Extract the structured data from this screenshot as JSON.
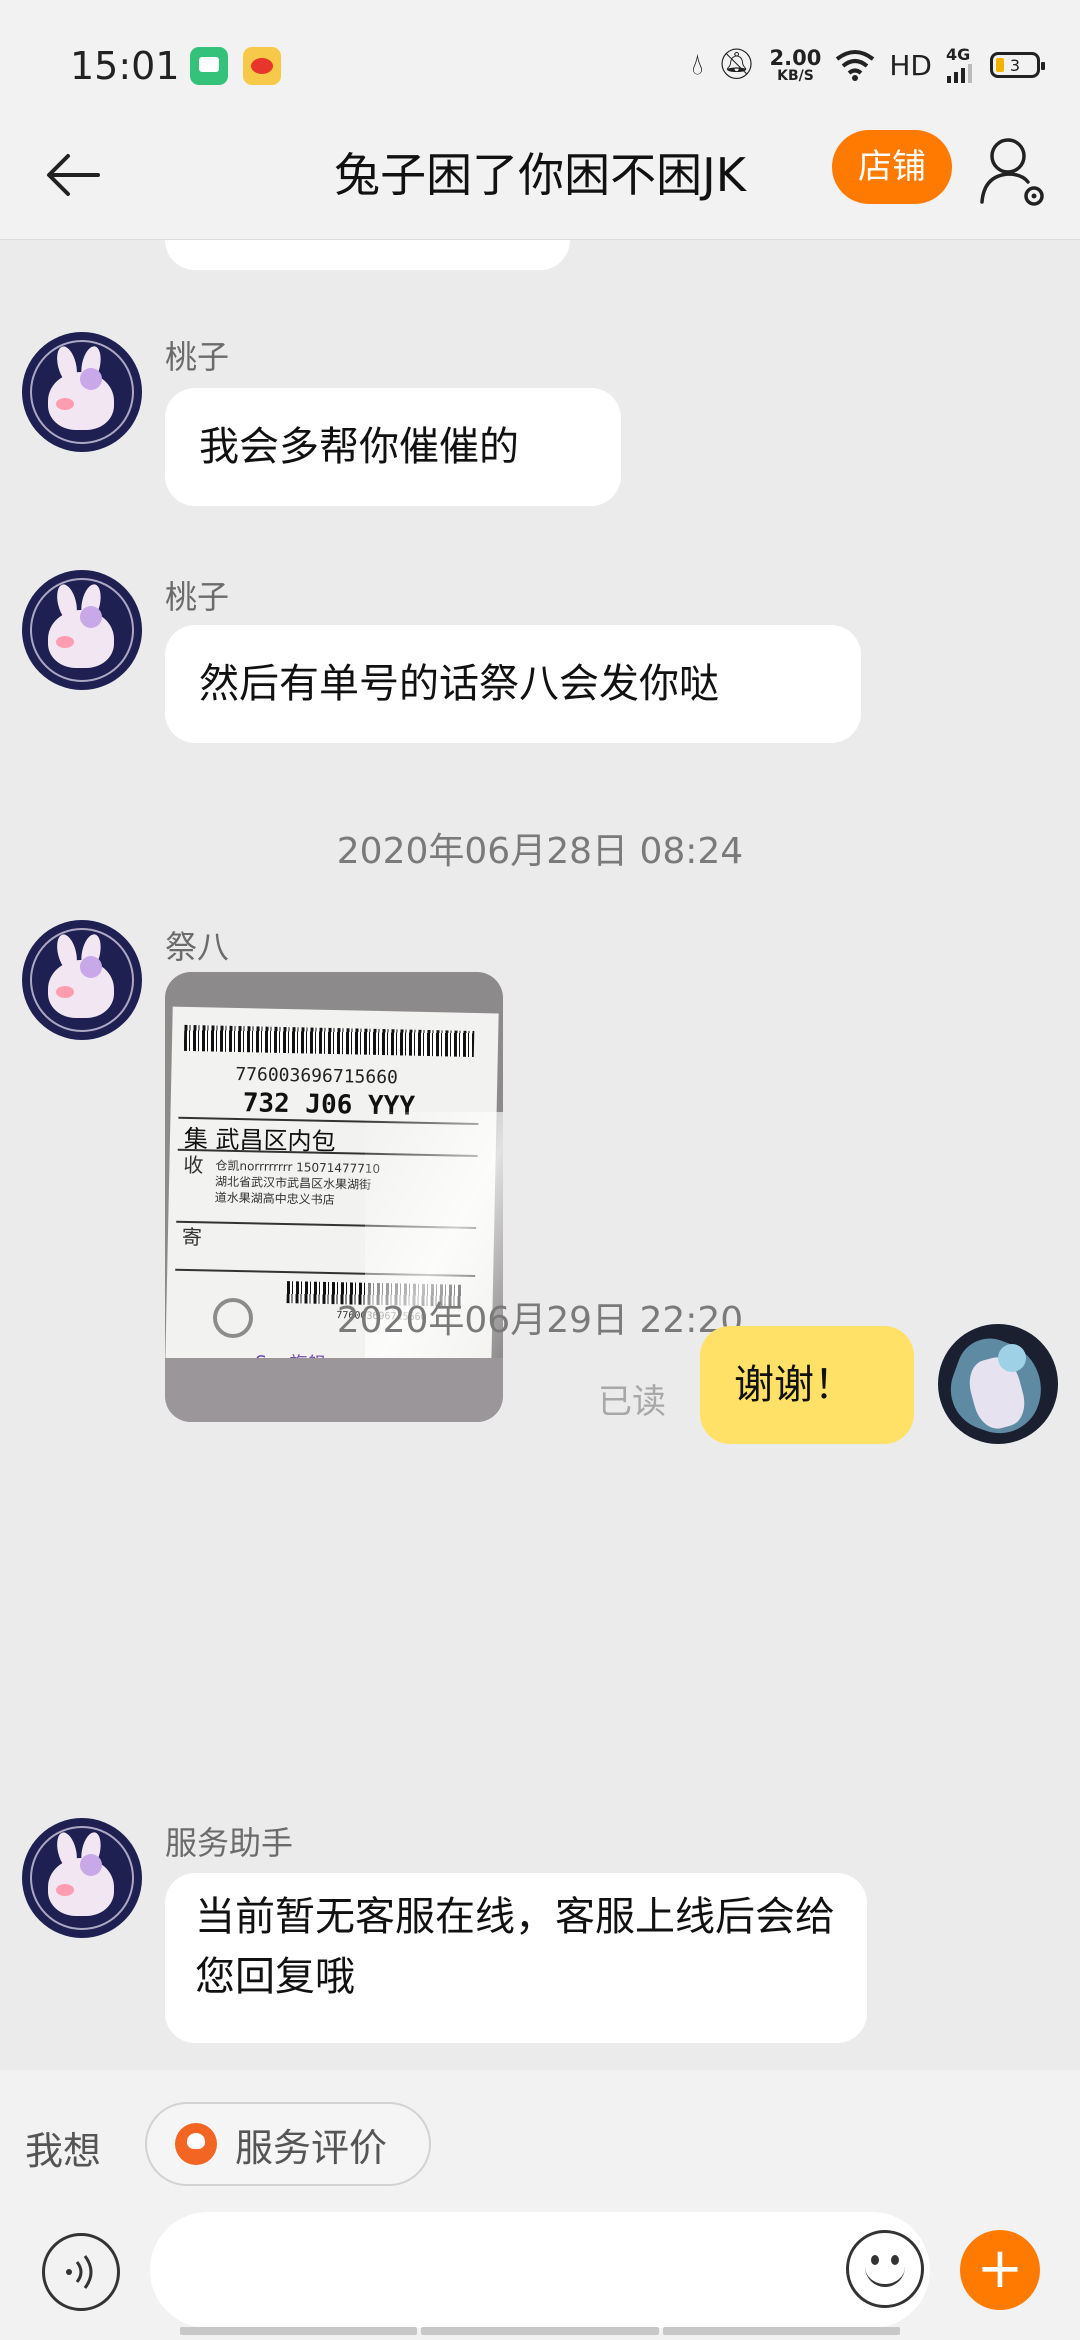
{
  "status_bar": {
    "time": "15:01",
    "net_speed_value": "2.00",
    "net_speed_unit": "KB/S",
    "hd": "HD",
    "network_type": "4G",
    "battery_level": "3",
    "icons": [
      "chat-app-icon",
      "weibo-icon",
      "water-drop-icon",
      "mute-icon",
      "wifi-icon",
      "signal-icon",
      "battery-icon"
    ]
  },
  "header": {
    "title": "兔子困了你困不困JK",
    "shop_button": "店铺",
    "icons": [
      "back-arrow-icon",
      "profile-settings-icon"
    ]
  },
  "messages": [
    {
      "sender": "桃子",
      "text": "我会多帮你催催的"
    },
    {
      "sender": "桃子",
      "text": "然后有单号的话祭八会发你哒"
    },
    {
      "timestamp": "2020年06月28日 08:24"
    },
    {
      "sender": "祭八",
      "image": {
        "tracking_number": "776003696715660",
        "route_code": "732 J06 YYY",
        "destination": "集 武昌区内包",
        "line_recv": "收",
        "line_send": "寄",
        "sticker_text": "Sun旗舰"
      }
    },
    {
      "timestamp": "2020年06月29日 22:20"
    },
    {
      "sender": "me",
      "text": "谢谢！",
      "status": "已读"
    },
    {
      "sender": "服务助手",
      "text": "当前暂无客服在线，客服上线后会给您回复哦"
    }
  ],
  "bottom_bar": {
    "quick_label": "我想",
    "chip_label": "服务评价",
    "input_placeholder": "",
    "icons": [
      "voice-icon",
      "emoji-icon",
      "plus-icon"
    ]
  },
  "colors": {
    "accent": "#ff7a00",
    "my_bubble": "#ffe167",
    "background": "#ebebeb"
  }
}
